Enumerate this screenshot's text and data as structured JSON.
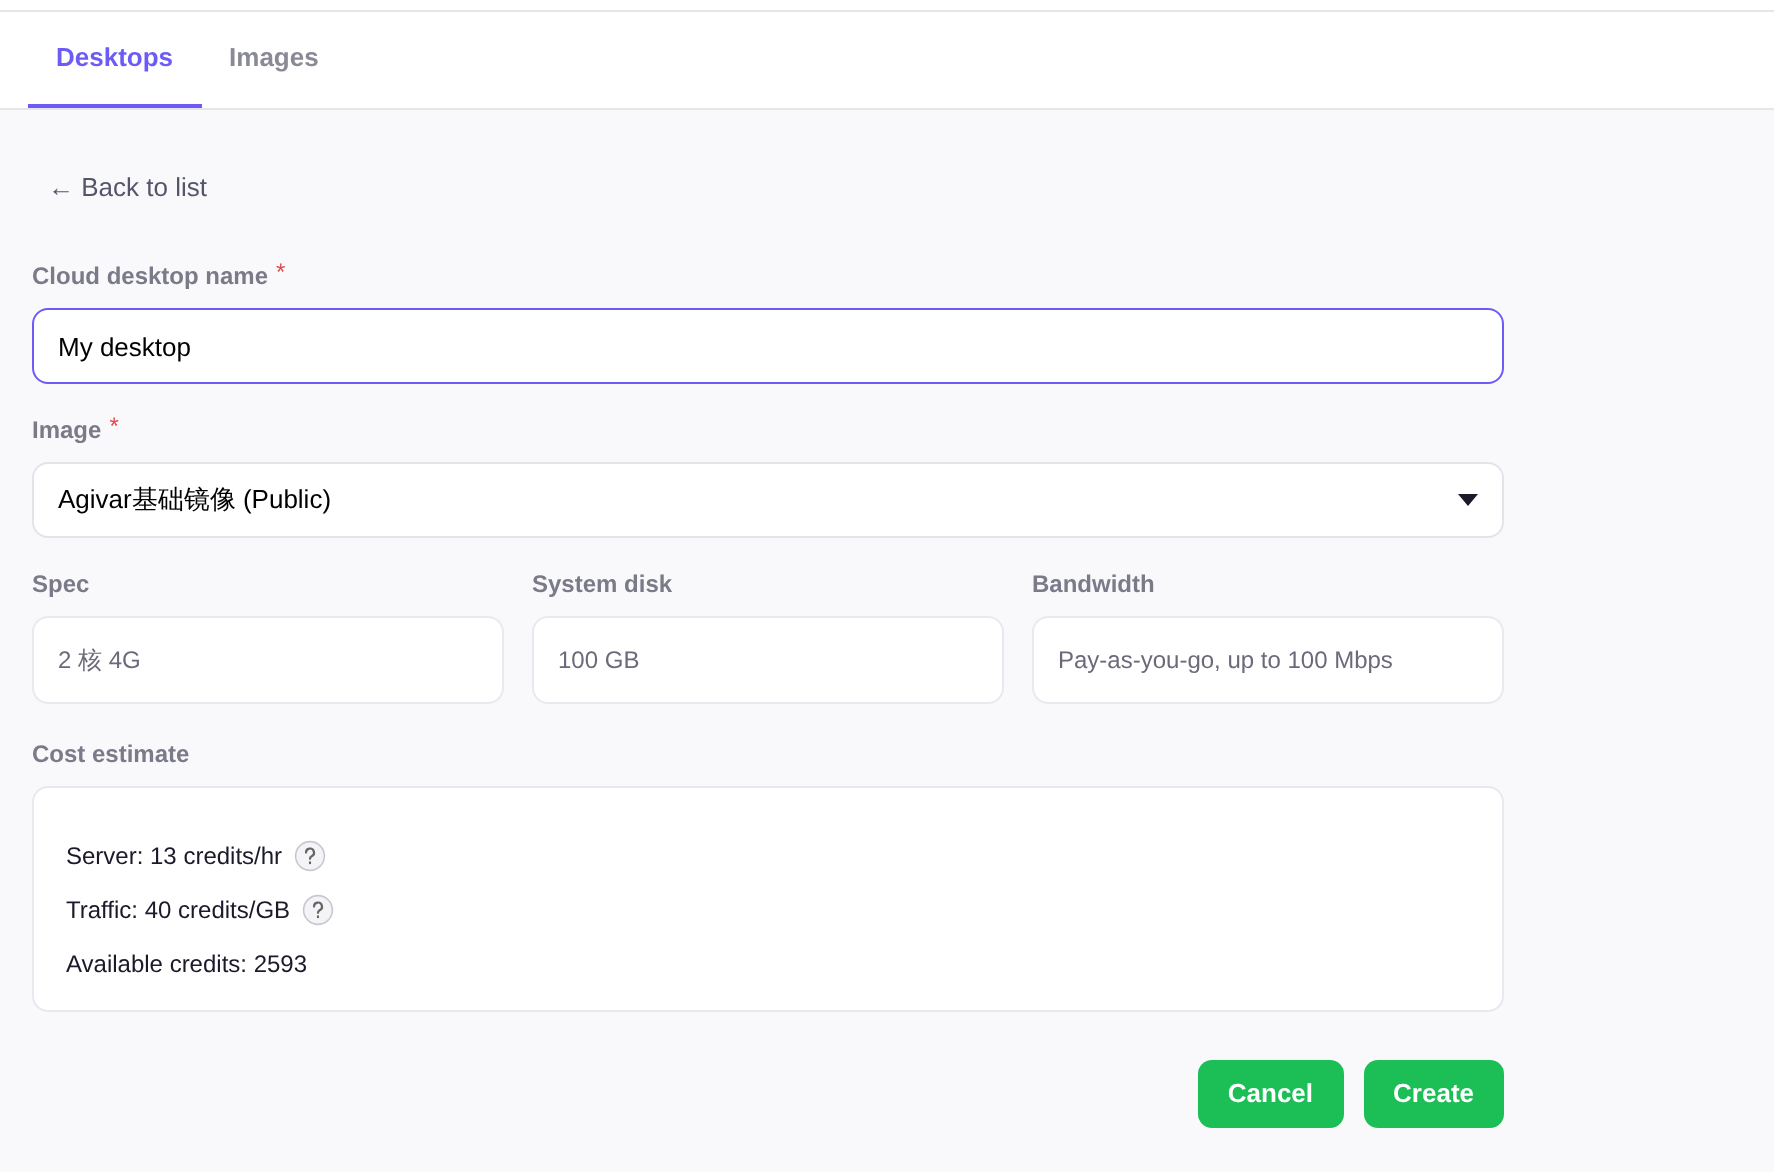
{
  "tabs": [
    {
      "label": "Desktops",
      "selected": true
    },
    {
      "label": "Images",
      "selected": false
    }
  ],
  "back_link": "← Back to list",
  "name_field": {
    "label": "Cloud desktop name",
    "required_mark": "*",
    "value": "My desktop",
    "focused": true
  },
  "image_field": {
    "label": "Image",
    "required_mark": "*",
    "value": "Agivar基础镜像 (Public)"
  },
  "spec_fields": [
    {
      "label": "Spec",
      "value": "2 核 4G"
    },
    {
      "label": "System disk",
      "value": "100 GB"
    },
    {
      "label": "Bandwidth",
      "value": "Pay-as-you-go, up to 100 Mbps"
    }
  ],
  "cost": {
    "label": "Cost estimate",
    "lines": [
      {
        "text": "Server: 13 credits/hr",
        "help": true
      },
      {
        "text": "Traffic: 40 credits/GB",
        "help": true
      },
      {
        "text": "Available credits: 2593",
        "help": false
      }
    ]
  },
  "buttons": [
    "Cancel",
    "Create"
  ]
}
